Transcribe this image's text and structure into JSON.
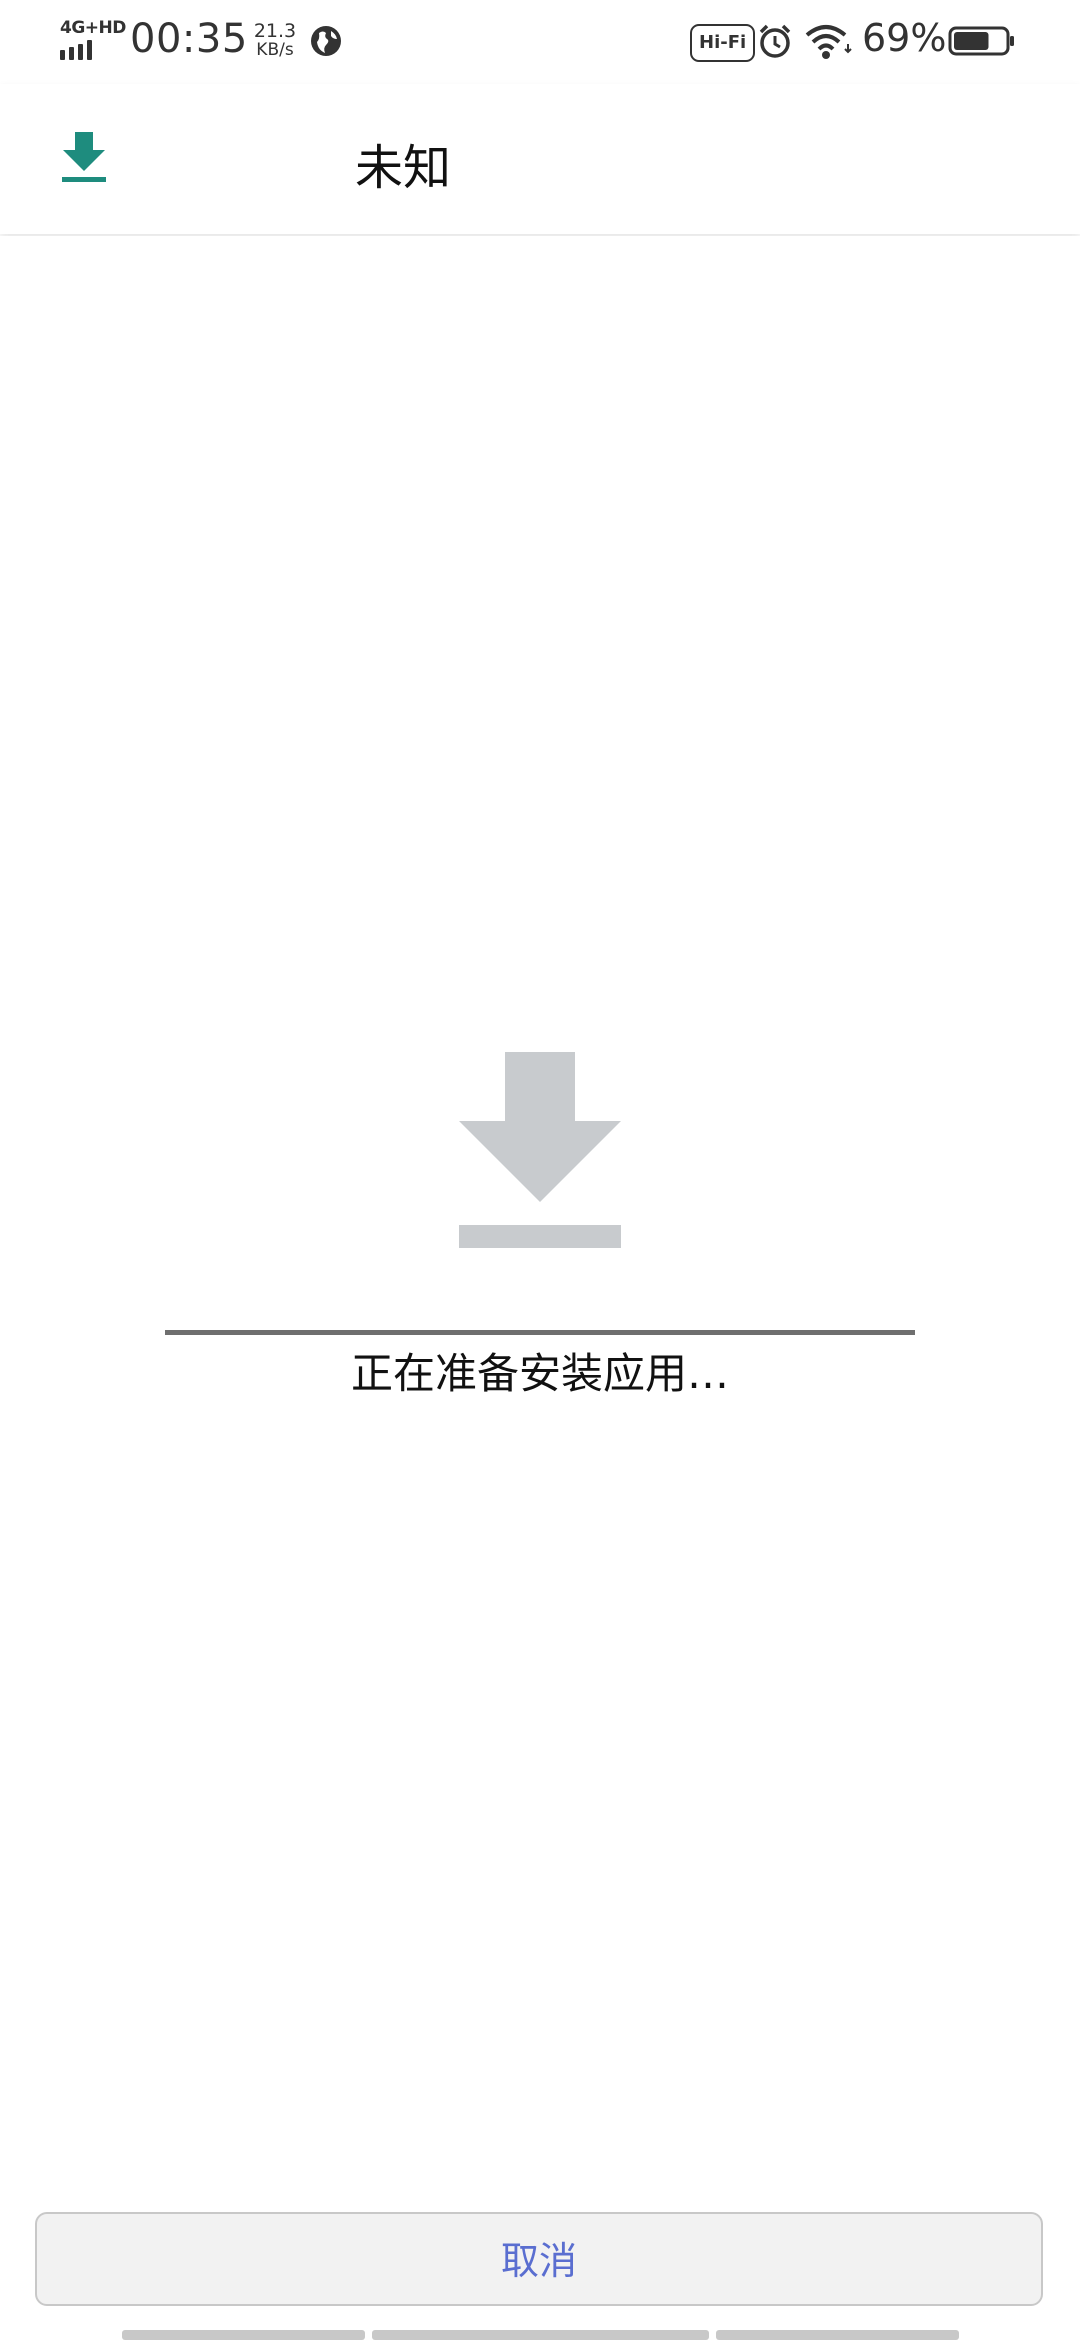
{
  "status_bar": {
    "network": "4G+HD",
    "time": "00:35",
    "speed_value": "21.3",
    "speed_unit": "KB/s",
    "hifi_label": "Hi-Fi",
    "battery_percent": "69%",
    "battery_level": 0.69
  },
  "app_bar": {
    "title": "未知",
    "icon": "download-icon",
    "accent_color": "#1e8c7e"
  },
  "main": {
    "icon": "download-icon",
    "progress_indeterminate": true,
    "status_text": "正在准备安装应用…"
  },
  "footer": {
    "cancel_label": "取消"
  }
}
